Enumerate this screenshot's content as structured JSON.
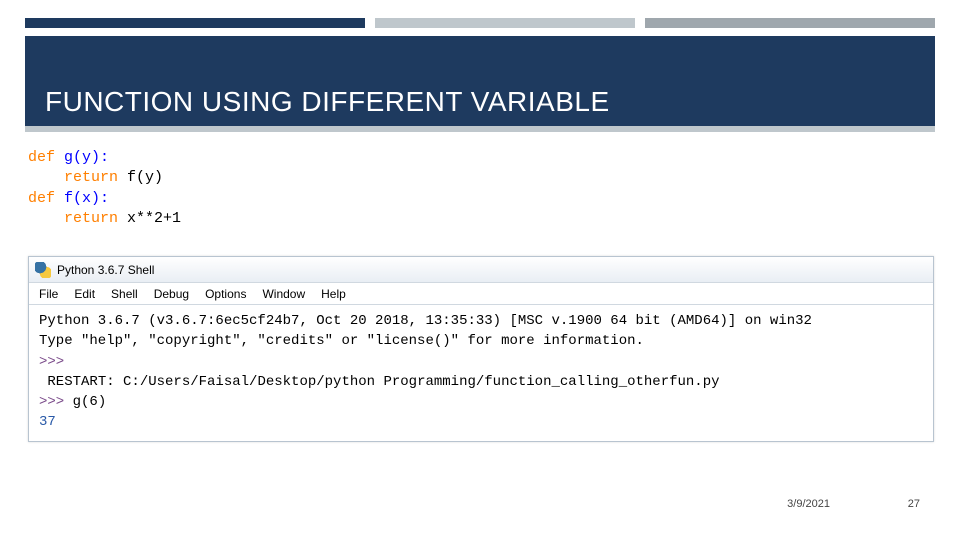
{
  "slide": {
    "title": "FUNCTION USING DIFFERENT VARIABLE",
    "date": "3/9/2021",
    "page": "27"
  },
  "stripe_widths": {
    "navy": 340,
    "white": 10,
    "gray1": 260,
    "white2": 10,
    "gray2": 290
  },
  "code": {
    "l1_def": "def ",
    "l1_fn": "g(y):",
    "l2_indent": "    ",
    "l2_kw": "return",
    "l2_rest": " f(y)",
    "blank": "",
    "l3_def": "def ",
    "l3_fn": "f(x):",
    "l4_indent": "    ",
    "l4_kw": "return",
    "l4_rest": " x**2+1"
  },
  "shell": {
    "title": "Python 3.6.7 Shell",
    "menu": [
      "File",
      "Edit",
      "Shell",
      "Debug",
      "Options",
      "Window",
      "Help"
    ],
    "banner1": "Python 3.6.7 (v3.6.7:6ec5cf24b7, Oct 20 2018, 13:35:33) [MSC v.1900 64 bit (AMD64)] on win32",
    "banner2": "Type \"help\", \"copyright\", \"credits\" or \"license()\" for more information.",
    "prompt1": ">>> ",
    "restart": " RESTART: C:/Users/Faisal/Desktop/python Programming/function_calling_otherfun.py ",
    "prompt2": ">>> ",
    "call": "g(6)",
    "result": "37"
  }
}
